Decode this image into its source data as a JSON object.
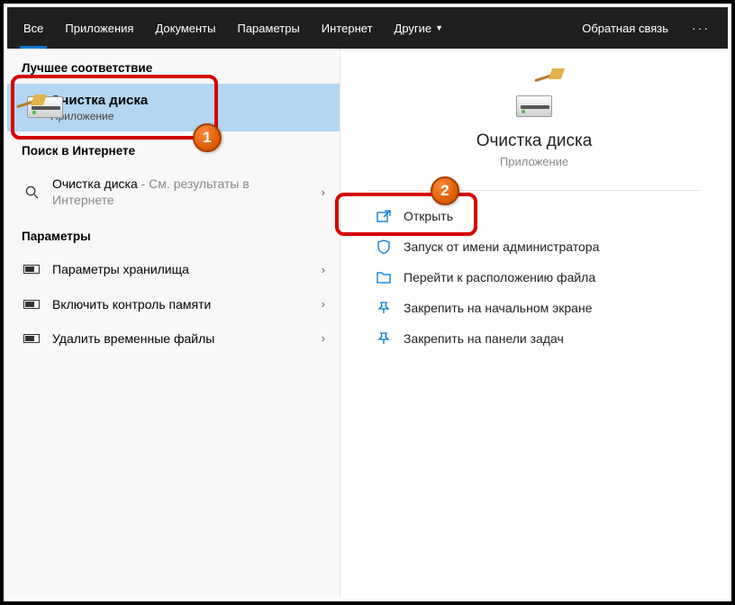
{
  "header": {
    "tabs": [
      "Все",
      "Приложения",
      "Документы",
      "Параметры",
      "Интернет"
    ],
    "more_tab": "Другие",
    "feedback": "Обратная связь"
  },
  "left": {
    "section_best": "Лучшее соответствие",
    "top_result": {
      "title": "Очистка диска",
      "subtitle": "Приложение"
    },
    "section_web": "Поиск в Интернете",
    "web_result": {
      "query": "Очистка диска",
      "suffix": " - См. результаты в Интернете"
    },
    "section_settings": "Параметры",
    "settings_items": [
      "Параметры хранилища",
      "Включить контроль памяти",
      "Удалить временные файлы"
    ]
  },
  "right": {
    "app_title": "Очистка диска",
    "app_sub": "Приложение",
    "actions": [
      "Открыть",
      "Запуск от имени администратора",
      "Перейти к расположению файла",
      "Закрепить на начальном экране",
      "Закрепить на панели задач"
    ]
  },
  "annotations": {
    "badge1": "1",
    "badge2": "2"
  }
}
